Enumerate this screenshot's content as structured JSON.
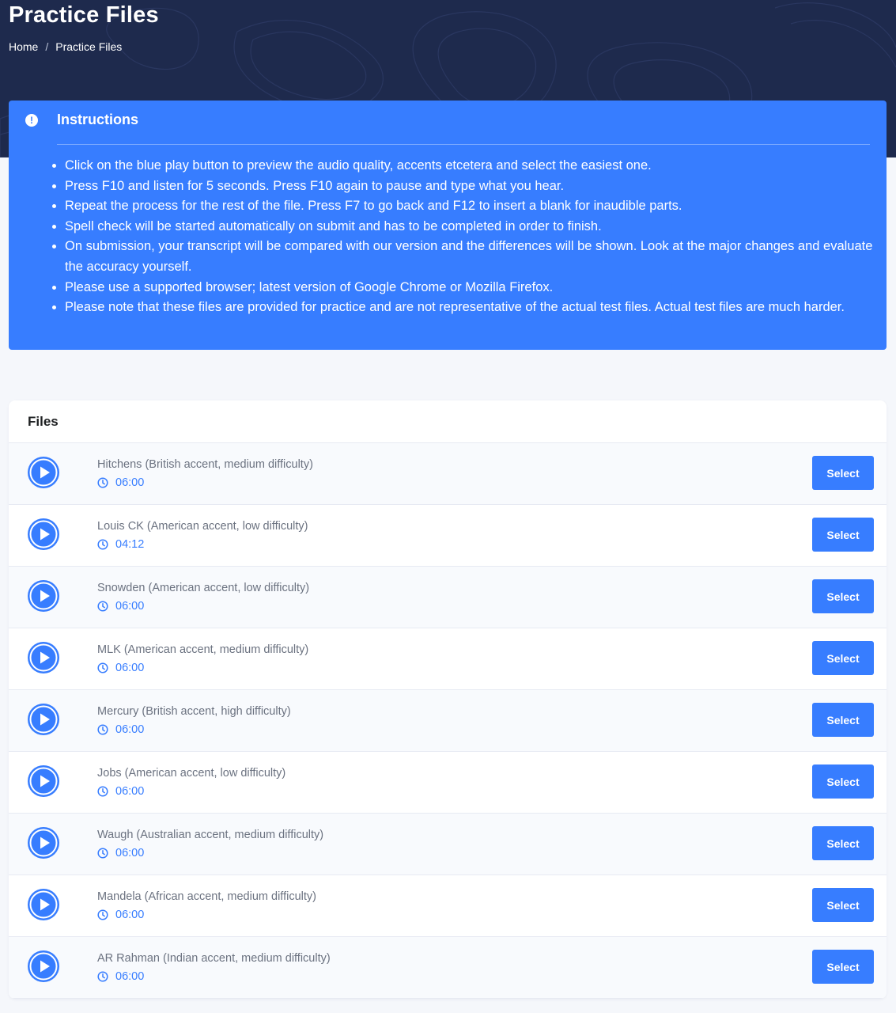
{
  "header": {
    "title": "Practice Files",
    "breadcrumb": {
      "home": "Home",
      "separator": "/",
      "current": "Practice Files"
    }
  },
  "instructions": {
    "icon": "exclamation-circle-icon",
    "title": "Instructions",
    "items": [
      "Click on the blue play button to preview the audio quality, accents etcetera and select the easiest one.",
      "Press F10 and listen for 5 seconds. Press F10 again to pause and type what you hear.",
      "Repeat the process for the rest of the file. Press F7 to go back and F12 to insert a blank for inaudible parts.",
      "Spell check will be started automatically on submit and has to be completed in order to finish.",
      "On submission, your transcript will be compared with our version and the differences will be shown. Look at the major changes and evaluate the accuracy yourself.",
      "Please use a supported browser; latest version of Google Chrome or Mozilla Firefox.",
      "Please note that these files are provided for practice and are not representative of the actual test files. Actual test files are much harder."
    ]
  },
  "files": {
    "heading": "Files",
    "select_label": "Select",
    "items": [
      {
        "name": "Hitchens (British accent, medium difficulty)",
        "duration": "06:00"
      },
      {
        "name": "Louis CK (American accent, low difficulty)",
        "duration": "04:12"
      },
      {
        "name": "Snowden (American accent, low difficulty)",
        "duration": "06:00"
      },
      {
        "name": "MLK (American accent, medium difficulty)",
        "duration": "06:00"
      },
      {
        "name": "Mercury (British accent, high difficulty)",
        "duration": "06:00"
      },
      {
        "name": "Jobs (American accent, low difficulty)",
        "duration": "06:00"
      },
      {
        "name": "Waugh (Australian accent, medium difficulty)",
        "duration": "06:00"
      },
      {
        "name": "Mandela (African accent, medium difficulty)",
        "duration": "06:00"
      },
      {
        "name": "AR Rahman (Indian accent, medium difficulty)",
        "duration": "06:00"
      }
    ]
  },
  "colors": {
    "hero_bg": "#1e2a4d",
    "accent": "#377dff",
    "page_bg": "#f5f7fb"
  }
}
